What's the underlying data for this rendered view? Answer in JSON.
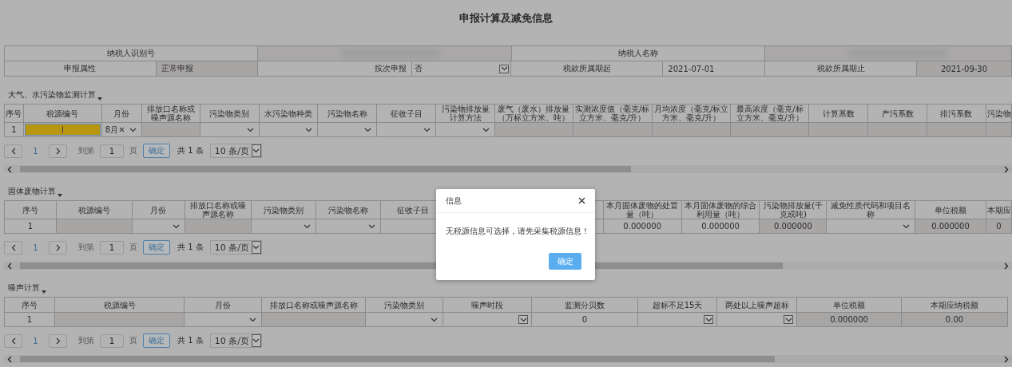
{
  "title": "申报计算及减免信息",
  "info": [
    [
      {
        "kind": "label",
        "text": "纳税人识别号"
      },
      {
        "kind": "redacted"
      },
      {
        "kind": "label",
        "text": "纳税人名称"
      },
      {
        "kind": "redacted"
      }
    ],
    [
      {
        "kind": "label",
        "text": "申报属性"
      },
      {
        "kind": "disabled",
        "text": "正常申报"
      },
      {
        "kind": "label-right",
        "text": "按次申报"
      },
      {
        "kind": "select",
        "text": "否"
      },
      {
        "kind": "label",
        "text": "税款所属期起"
      },
      {
        "kind": "value",
        "text": "2021-07-01"
      },
      {
        "kind": "label",
        "text": "税款所属期止"
      },
      {
        "kind": "disabled-center",
        "text": "2021-09-30"
      }
    ]
  ],
  "sections": [
    {
      "title": "大气、水污染物监测计算",
      "columns": [
        "序号",
        "税源编号",
        "月份",
        "排放口名称或噪声源名称",
        "污染物类别",
        "水污染物种类",
        "污染物名称",
        "征收子目",
        "污染物排放量计算方法",
        "废气（废水）排放量（万标立方米、吨）",
        "实测浓度值（毫克/标立方米、毫克/升）",
        "月均浓度（毫克/标立方米、毫克/升）",
        "最高浓度（毫克/标立方米、毫克/升）",
        "计算基数",
        "产污系数",
        "排污系数",
        "污染物"
      ],
      "row": [
        {
          "kind": "text",
          "text": "1"
        },
        {
          "kind": "highlight"
        },
        {
          "kind": "select",
          "text": "8月",
          "clearable": true
        },
        {
          "kind": "disabled"
        },
        {
          "kind": "select"
        },
        {
          "kind": "select"
        },
        {
          "kind": "select"
        },
        {
          "kind": "select"
        },
        {
          "kind": "select"
        },
        {
          "kind": "disabled"
        },
        {
          "kind": "disabled"
        },
        {
          "kind": "disabled"
        },
        {
          "kind": "disabled"
        },
        {
          "kind": "disabled"
        },
        {
          "kind": "disabled"
        },
        {
          "kind": "disabled"
        },
        {
          "kind": "disabled"
        }
      ],
      "pager": {
        "page": "1",
        "goto": "到第",
        "goto_value": "1",
        "unit": "页",
        "confirm": "确定",
        "total": "共 1 条",
        "size": "10 条/页"
      }
    },
    {
      "title": "固体废物计算",
      "columns": [
        "序号",
        "税源编号",
        "月份",
        "排放口名称或噪声源名称",
        "污染物类别",
        "污染物名称",
        "征收子目",
        "本月固体废物的处置量（吨）",
        "本月固体废物的综合利用量（吨）",
        "污染物排放量(千克或吨)",
        "减免性质代码和项目名称",
        "单位税额",
        "本期应"
      ],
      "row": [
        {
          "kind": "text",
          "text": "1"
        },
        {
          "kind": "disabled"
        },
        {
          "kind": "select"
        },
        {
          "kind": "disabled"
        },
        {
          "kind": "select"
        },
        {
          "kind": "select"
        },
        {
          "kind": "text"
        },
        {
          "kind": "text",
          "text": "0.000000"
        },
        {
          "kind": "text",
          "text": "0.000000"
        },
        {
          "kind": "disabled",
          "text": "0.000000"
        },
        {
          "kind": "select"
        },
        {
          "kind": "disabled",
          "text": "0.000000"
        },
        {
          "kind": "disabled",
          "text": "0"
        }
      ],
      "pager": {
        "page": "1",
        "goto": "到第",
        "goto_value": "1",
        "unit": "页",
        "confirm": "确定",
        "total": "共 1 条",
        "size": "10 条/页"
      }
    },
    {
      "title": "噪声计算",
      "columns": [
        "序号",
        "税源编号",
        "月份",
        "排放口名称或噪声源名称",
        "污染物类别",
        "噪声时段",
        "监测分贝数",
        "超标不足15天",
        "两处以上噪声超标",
        "单位税额",
        "本期应纳税额"
      ],
      "row": [
        {
          "kind": "text",
          "text": "1"
        },
        {
          "kind": "disabled"
        },
        {
          "kind": "select"
        },
        {
          "kind": "disabled"
        },
        {
          "kind": "select"
        },
        {
          "kind": "select-box"
        },
        {
          "kind": "text",
          "text": "0"
        },
        {
          "kind": "select-box"
        },
        {
          "kind": "select-box"
        },
        {
          "kind": "disabled",
          "text": "0.000000"
        },
        {
          "kind": "disabled",
          "text": "0.00"
        }
      ],
      "pager": {
        "page": "1",
        "goto": "到第",
        "goto_value": "1",
        "unit": "页",
        "confirm": "确定",
        "total": "共 1 条",
        "size": "10 条/页"
      }
    }
  ],
  "dialog": {
    "title": "信息",
    "message": "无税源信息可选择，请先采集税源信息！",
    "button": "确定"
  }
}
